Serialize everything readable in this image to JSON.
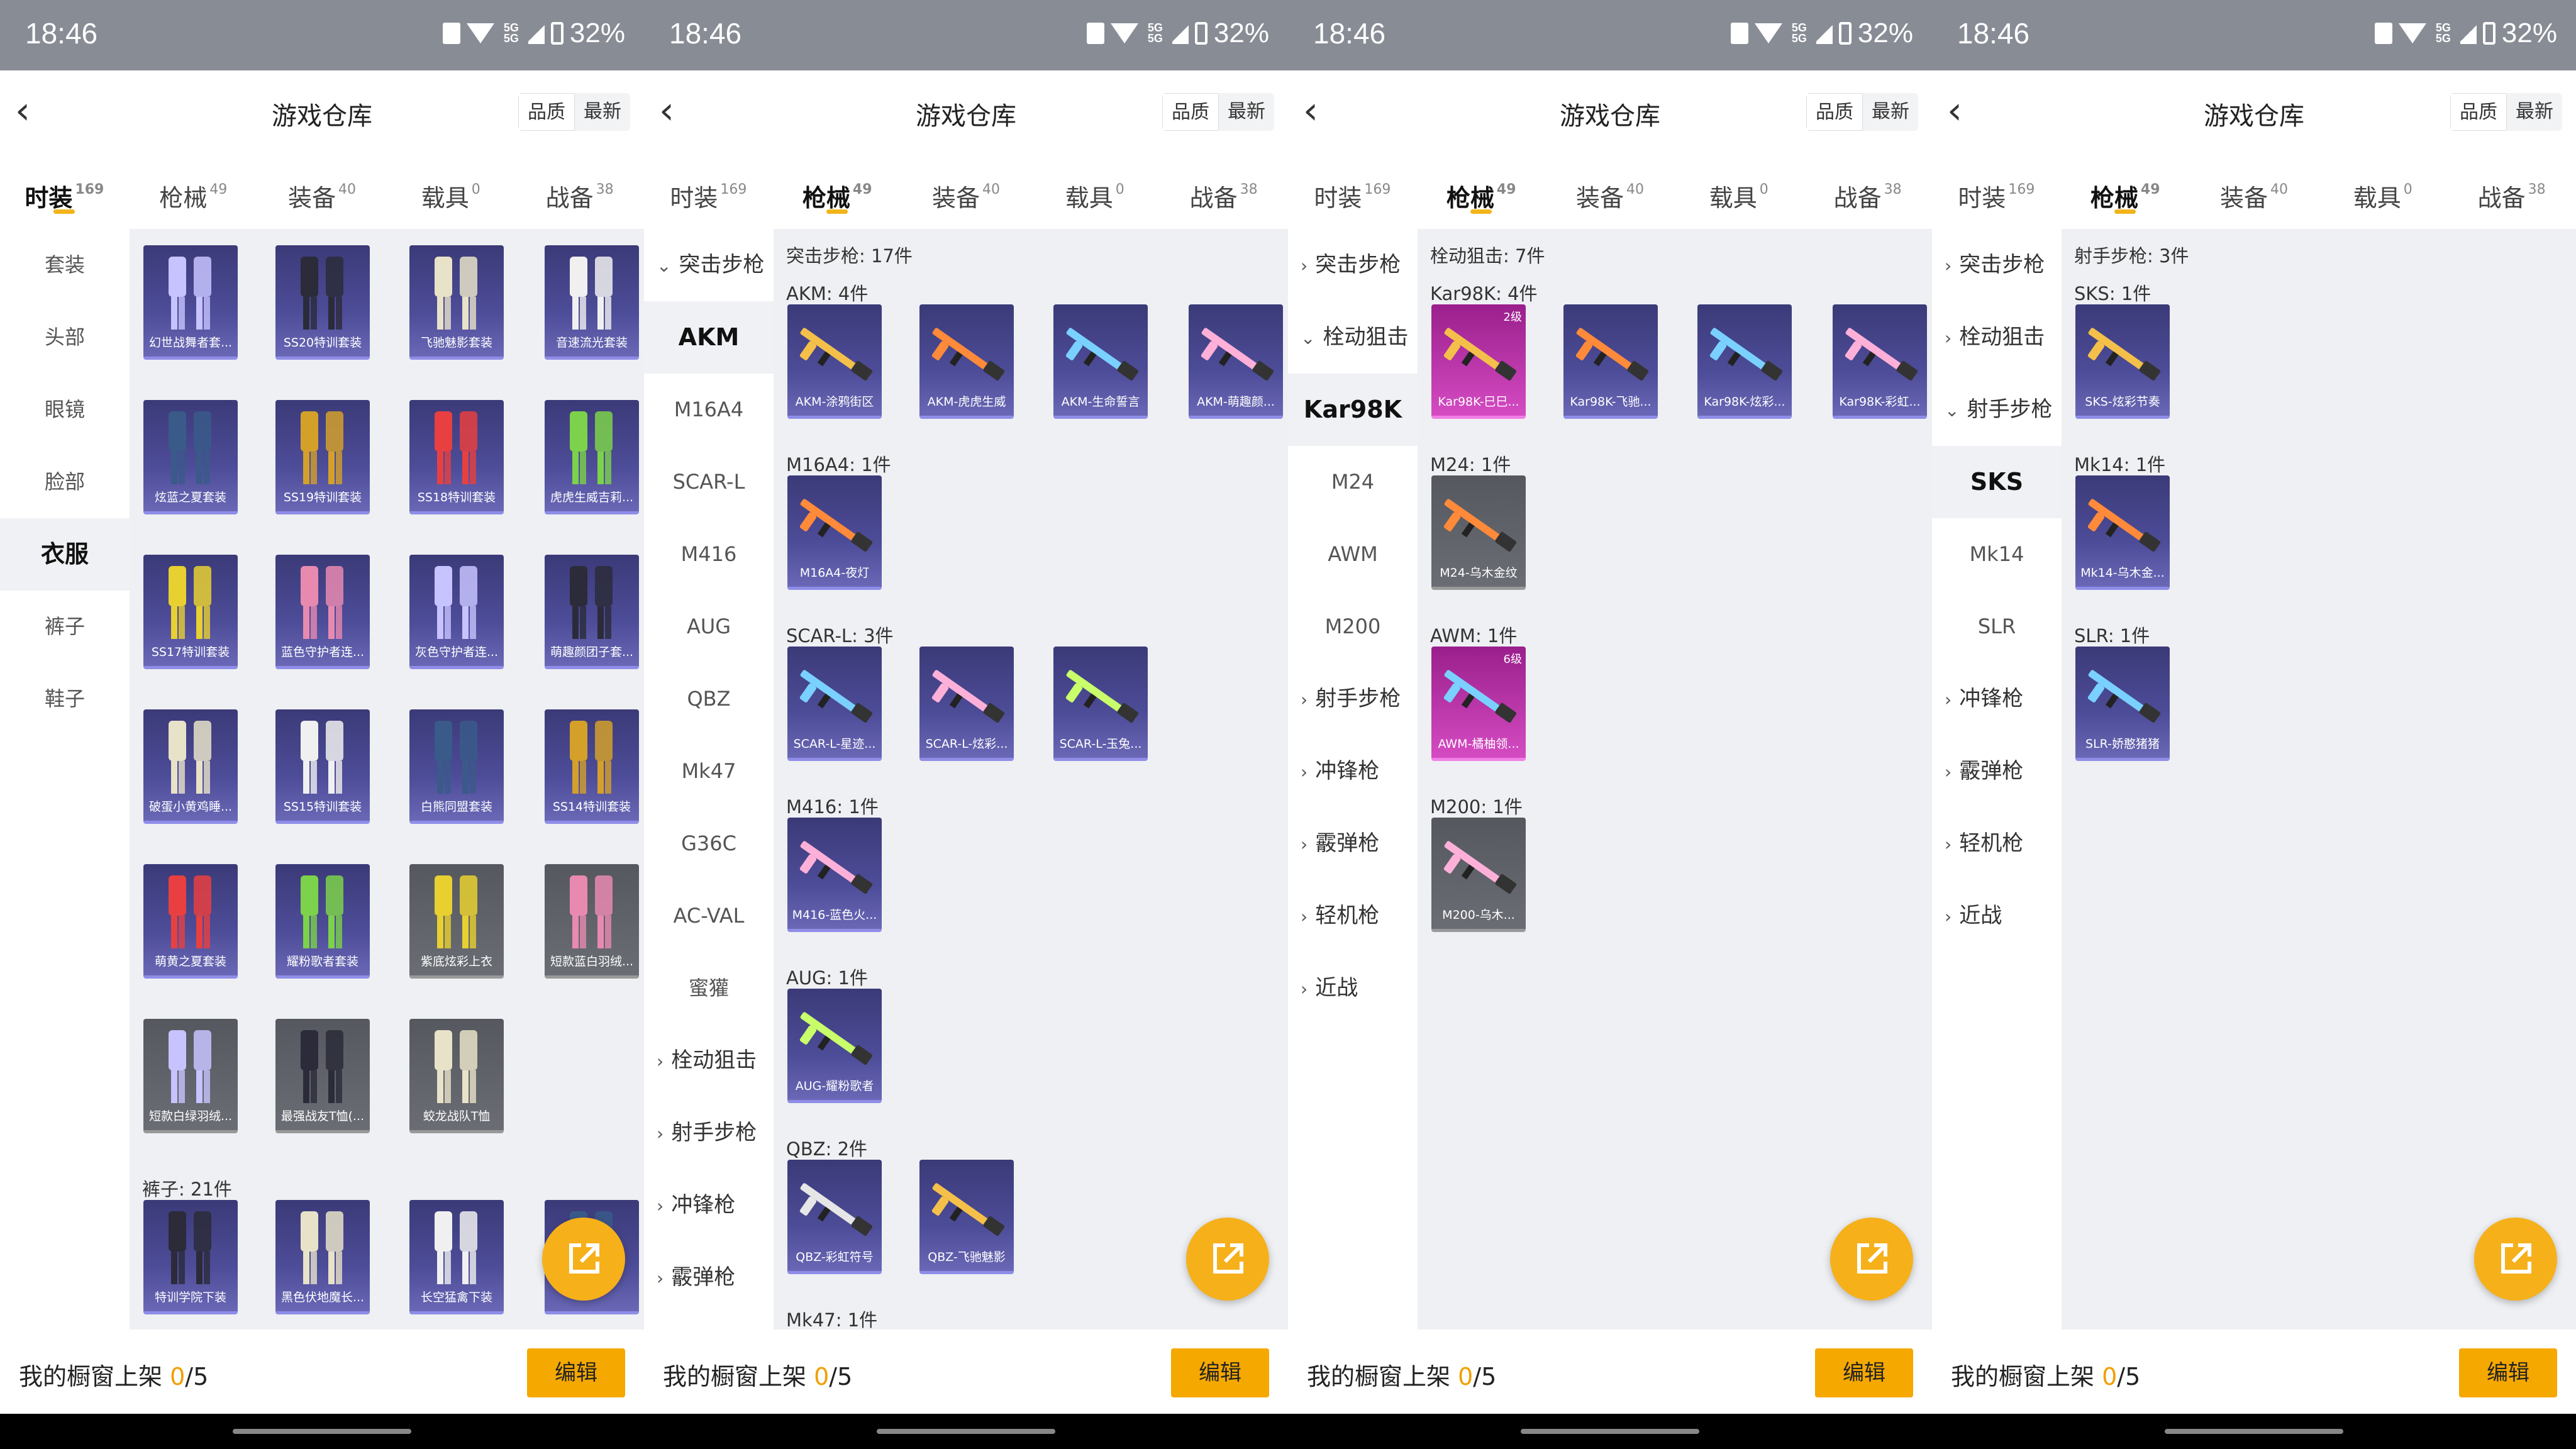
{
  "status": {
    "time": "18:46",
    "battery": "32%",
    "net": "5G"
  },
  "colors": {
    "accent": "#f5a800",
    "card_purple": "#4d4c98",
    "card_pink": "#d54bc2"
  },
  "header": {
    "title": "游戏仓库",
    "sort_quality": "品质",
    "sort_latest": "最新"
  },
  "tabs": [
    {
      "label": "时装",
      "count": "169"
    },
    {
      "label": "枪械",
      "count": "49"
    },
    {
      "label": "装备",
      "count": "40"
    },
    {
      "label": "载具",
      "count": "0"
    },
    {
      "label": "战备",
      "count": "38"
    }
  ],
  "bottom": {
    "prefix": "我的橱窗上架 ",
    "current": "0",
    "total": "/5",
    "edit_label": "编辑"
  },
  "screens": [
    {
      "active_tab": 0,
      "sidebar": [
        {
          "label": "套装"
        },
        {
          "label": "头部"
        },
        {
          "label": "眼镜"
        },
        {
          "label": "脸部"
        },
        {
          "label": "衣服",
          "active": true
        },
        {
          "label": "裤子"
        },
        {
          "label": "鞋子"
        }
      ],
      "sections": [
        {
          "title": "",
          "items": [
            {
              "label": "幻世战舞者套..."
            },
            {
              "label": "SS20特训套装"
            },
            {
              "label": "飞驰魅影套装"
            },
            {
              "label": "音速流光套装"
            },
            {
              "label": "炫蓝之夏套装"
            },
            {
              "label": "SS19特训套装"
            },
            {
              "label": "SS18特训套装"
            },
            {
              "label": "虎虎生威吉莉..."
            },
            {
              "label": "SS17特训套装"
            },
            {
              "label": "蓝色守护者连..."
            },
            {
              "label": "灰色守护者连..."
            },
            {
              "label": "萌趣颜团子套..."
            },
            {
              "label": "破蛋小黄鸡睡..."
            },
            {
              "label": "SS15特训套装"
            },
            {
              "label": "白熊同盟套装"
            },
            {
              "label": "SS14特训套装"
            },
            {
              "label": "萌黄之夏套装"
            },
            {
              "label": "耀粉歌者套装"
            },
            {
              "label": "紫底炫彩上衣",
              "tone": "gray"
            },
            {
              "label": "短款蓝白羽绒...",
              "tone": "gray"
            },
            {
              "label": "短款白绿羽绒...",
              "tone": "gray"
            },
            {
              "label": "最强战友T恤(...",
              "tone": "gray"
            },
            {
              "label": "蛟龙战队T恤",
              "tone": "gray"
            }
          ]
        },
        {
          "title": "裤子: 21件",
          "items": [
            {
              "label": "特训学院下装"
            },
            {
              "label": "黑色伏地魔长..."
            },
            {
              "label": "长空猛禽下装"
            },
            {
              "label": ""
            }
          ]
        }
      ]
    },
    {
      "active_tab": 1,
      "sidebar": [
        {
          "label": "突击步枪",
          "cat": true,
          "open": true
        },
        {
          "label": "AKM",
          "active": true
        },
        {
          "label": "M16A4"
        },
        {
          "label": "SCAR-L"
        },
        {
          "label": "M416"
        },
        {
          "label": "AUG"
        },
        {
          "label": "QBZ"
        },
        {
          "label": "Mk47"
        },
        {
          "label": "G36C"
        },
        {
          "label": "AC-VAL"
        },
        {
          "label": "蜜獾"
        },
        {
          "label": "栓动狙击",
          "cat": true
        },
        {
          "label": "射手步枪",
          "cat": true
        },
        {
          "label": "冲锋枪",
          "cat": true
        },
        {
          "label": "霰弹枪",
          "cat": true
        }
      ],
      "header_line": "突击步枪: 17件",
      "sections": [
        {
          "title": "AKM: 4件",
          "items": [
            {
              "label": "AKM-涂鸦街区"
            },
            {
              "label": "AKM-虎虎生威"
            },
            {
              "label": "AKM-生命誓言"
            },
            {
              "label": "AKM-萌趣颜..."
            }
          ]
        },
        {
          "title": "M16A4: 1件",
          "items": [
            {
              "label": "M16A4-夜灯"
            }
          ]
        },
        {
          "title": "SCAR-L: 3件",
          "items": [
            {
              "label": "SCAR-L-星迹..."
            },
            {
              "label": "SCAR-L-炫彩..."
            },
            {
              "label": "SCAR-L-玉兔..."
            }
          ]
        },
        {
          "title": "M416: 1件",
          "items": [
            {
              "label": "M416-蓝色火..."
            }
          ]
        },
        {
          "title": "AUG: 1件",
          "items": [
            {
              "label": "AUG-耀粉歌者"
            }
          ]
        },
        {
          "title": "QBZ: 2件",
          "items": [
            {
              "label": "QBZ-彩虹符号"
            },
            {
              "label": "QBZ-飞驰魅影"
            }
          ]
        },
        {
          "title": "Mk47: 1件",
          "items": [
            {
              "label": ""
            }
          ]
        }
      ]
    },
    {
      "active_tab": 1,
      "sidebar": [
        {
          "label": "突击步枪",
          "cat": true
        },
        {
          "label": "栓动狙击",
          "cat": true,
          "open": true
        },
        {
          "label": "Kar98K",
          "active": true
        },
        {
          "label": "M24"
        },
        {
          "label": "AWM"
        },
        {
          "label": "M200"
        },
        {
          "label": "射手步枪",
          "cat": true
        },
        {
          "label": "冲锋枪",
          "cat": true
        },
        {
          "label": "霰弹枪",
          "cat": true
        },
        {
          "label": "轻机枪",
          "cat": true
        },
        {
          "label": "近战",
          "cat": true
        }
      ],
      "header_line": "栓动狙击: 7件",
      "sections": [
        {
          "title": "Kar98K: 4件",
          "items": [
            {
              "label": "Kar98K-巳巳...",
              "tone": "pink",
              "level": "2级"
            },
            {
              "label": "Kar98K-飞驰..."
            },
            {
              "label": "Kar98K-炫彩..."
            },
            {
              "label": "Kar98K-彩虹..."
            }
          ]
        },
        {
          "title": "M24: 1件",
          "items": [
            {
              "label": "M24-乌木金纹",
              "tone": "gray"
            }
          ]
        },
        {
          "title": "AWM: 1件",
          "items": [
            {
              "label": "AWM-橘柚领...",
              "tone": "pink",
              "level": "6级"
            }
          ]
        },
        {
          "title": "M200: 1件",
          "items": [
            {
              "label": "M200-乌木...",
              "tone": "gray"
            }
          ]
        }
      ]
    },
    {
      "active_tab": 1,
      "sidebar": [
        {
          "label": "突击步枪",
          "cat": true
        },
        {
          "label": "栓动狙击",
          "cat": true
        },
        {
          "label": "射手步枪",
          "cat": true,
          "open": true
        },
        {
          "label": "SKS",
          "active": true
        },
        {
          "label": "Mk14"
        },
        {
          "label": "SLR"
        },
        {
          "label": "冲锋枪",
          "cat": true
        },
        {
          "label": "霰弹枪",
          "cat": true
        },
        {
          "label": "轻机枪",
          "cat": true
        },
        {
          "label": "近战",
          "cat": true
        }
      ],
      "header_line": "射手步枪: 3件",
      "sections": [
        {
          "title": "SKS: 1件",
          "items": [
            {
              "label": "SKS-炫彩节奏"
            }
          ]
        },
        {
          "title": "Mk14: 1件",
          "items": [
            {
              "label": "Mk14-乌木金..."
            }
          ]
        },
        {
          "title": "SLR: 1件",
          "items": [
            {
              "label": "SLR-娇憨猪猪"
            }
          ]
        }
      ]
    }
  ]
}
